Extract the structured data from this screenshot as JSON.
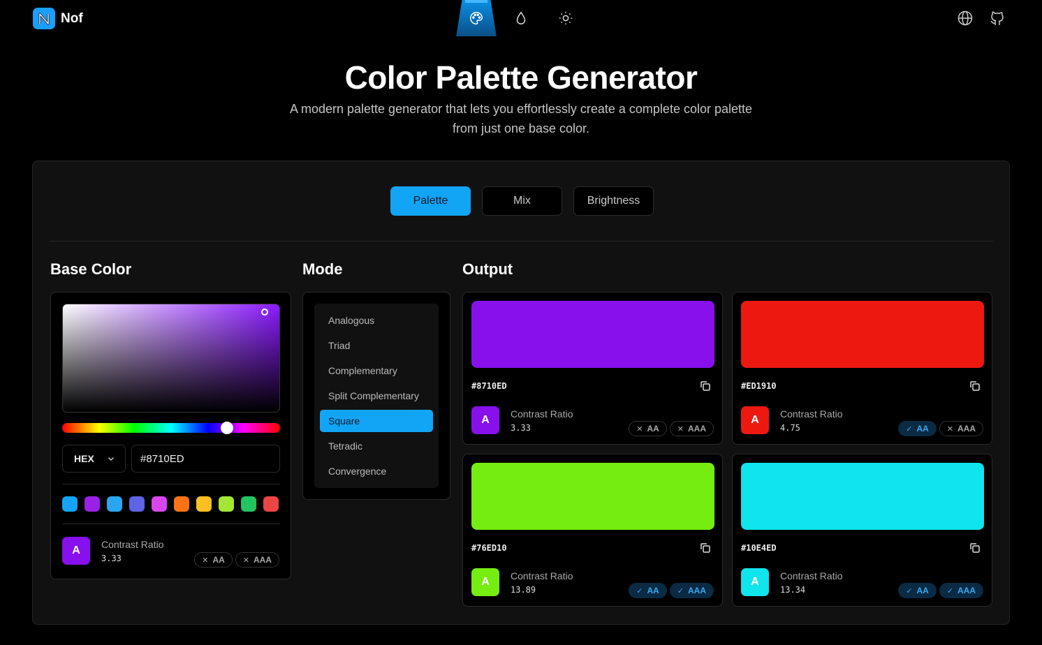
{
  "brand": {
    "name": "Nof",
    "logo_letter": "N"
  },
  "nav": [
    {
      "icon": "palette-icon",
      "active": true
    },
    {
      "icon": "drop-icon",
      "active": false
    },
    {
      "icon": "sun-icon",
      "active": false
    }
  ],
  "right_icons": [
    "globe-icon",
    "github-icon"
  ],
  "hero": {
    "title": "Color Palette Generator",
    "subtitle": "A modern palette generator that lets you effortlessly create a complete color palette from just one base color."
  },
  "tabs": [
    {
      "label": "Palette",
      "active": true
    },
    {
      "label": "Mix",
      "active": false
    },
    {
      "label": "Brightness",
      "active": false
    }
  ],
  "base": {
    "heading": "Base Color",
    "format": "HEX",
    "value": "#8710ED",
    "presets": [
      "#14a3f5",
      "#9a20e8",
      "#2aa5f0",
      "#5f63e6",
      "#d946ef",
      "#f97316",
      "#fbbf24",
      "#a3e635",
      "#22c55e",
      "#ef4444"
    ],
    "contrast": {
      "letter": "A",
      "label": "Contrast Ratio",
      "ratio": "3.33",
      "aa": "AA",
      "aaa": "AAA",
      "aa_pass": false,
      "aaa_pass": false,
      "color": "#8710ED"
    }
  },
  "mode": {
    "heading": "Mode",
    "items": [
      "Analogous",
      "Triad",
      "Complementary",
      "Split Complementary",
      "Square",
      "Tetradic",
      "Convergence"
    ],
    "selected": "Square"
  },
  "output": {
    "heading": "Output",
    "colors": [
      {
        "hex": "#8710ED",
        "letter": "A",
        "label": "Contrast Ratio",
        "ratio": "3.33",
        "aa": "AA",
        "aaa": "AAA",
        "aa_pass": false,
        "aaa_pass": false
      },
      {
        "hex": "#ED1910",
        "letter": "A",
        "label": "Contrast Ratio",
        "ratio": "4.75",
        "aa": "AA",
        "aaa": "AAA",
        "aa_pass": true,
        "aaa_pass": false
      },
      {
        "hex": "#76ED10",
        "letter": "A",
        "label": "Contrast Ratio",
        "ratio": "13.89",
        "aa": "AA",
        "aaa": "AAA",
        "aa_pass": true,
        "aaa_pass": true
      },
      {
        "hex": "#10E4ED",
        "letter": "A",
        "label": "Contrast Ratio",
        "ratio": "13.34",
        "aa": "AA",
        "aaa": "AAA",
        "aa_pass": true,
        "aaa_pass": true
      }
    ]
  },
  "colors": {
    "accent": "#12a4f5",
    "pass_badge_bg": "#0b2a44",
    "pass_badge_text": "#38aaf5"
  }
}
